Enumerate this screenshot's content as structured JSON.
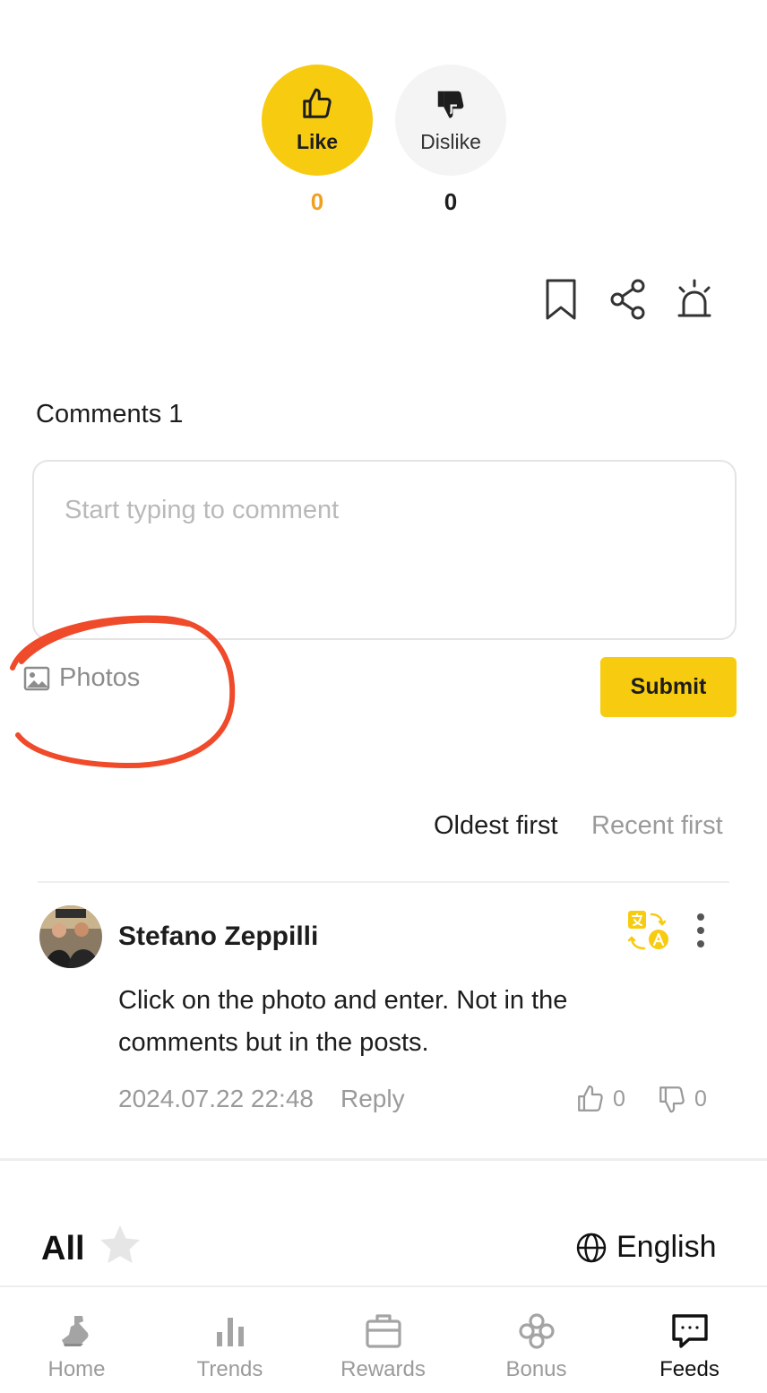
{
  "reactions": {
    "like_label": "Like",
    "like_count": "0",
    "dislike_label": "Dislike",
    "dislike_count": "0"
  },
  "actions": {
    "icons": [
      "bookmark-icon",
      "share-icon",
      "alert-icon"
    ]
  },
  "comments": {
    "title": "Comments 1",
    "input_placeholder": "Start typing to comment",
    "input_value": "",
    "photos_label": "Photos",
    "submit_label": "Submit",
    "sort": {
      "oldest_label": "Oldest first",
      "recent_label": "Recent first",
      "selected": "Oldest first"
    },
    "items": [
      {
        "author": "Stefano Zeppilli",
        "text": "Click on the photo and enter. Not in the comments but in the posts.",
        "date": "2024.07.22 22:48",
        "reply_label": "Reply",
        "likes": "0",
        "dislikes": "0"
      }
    ]
  },
  "filter": {
    "label": "All",
    "language": "English"
  },
  "tabs": [
    {
      "label": "Home",
      "icon": "home-icon"
    },
    {
      "label": "Trends",
      "icon": "trends-icon"
    },
    {
      "label": "Rewards",
      "icon": "rewards-icon"
    },
    {
      "label": "Bonus",
      "icon": "bonus-icon"
    },
    {
      "label": "Feeds",
      "icon": "feeds-icon",
      "active": true
    }
  ],
  "colors": {
    "accent": "#f7cb0f",
    "like_count": "#f0a020",
    "muted_text": "#9a9a9a",
    "annotation": "#ef4a2a"
  }
}
